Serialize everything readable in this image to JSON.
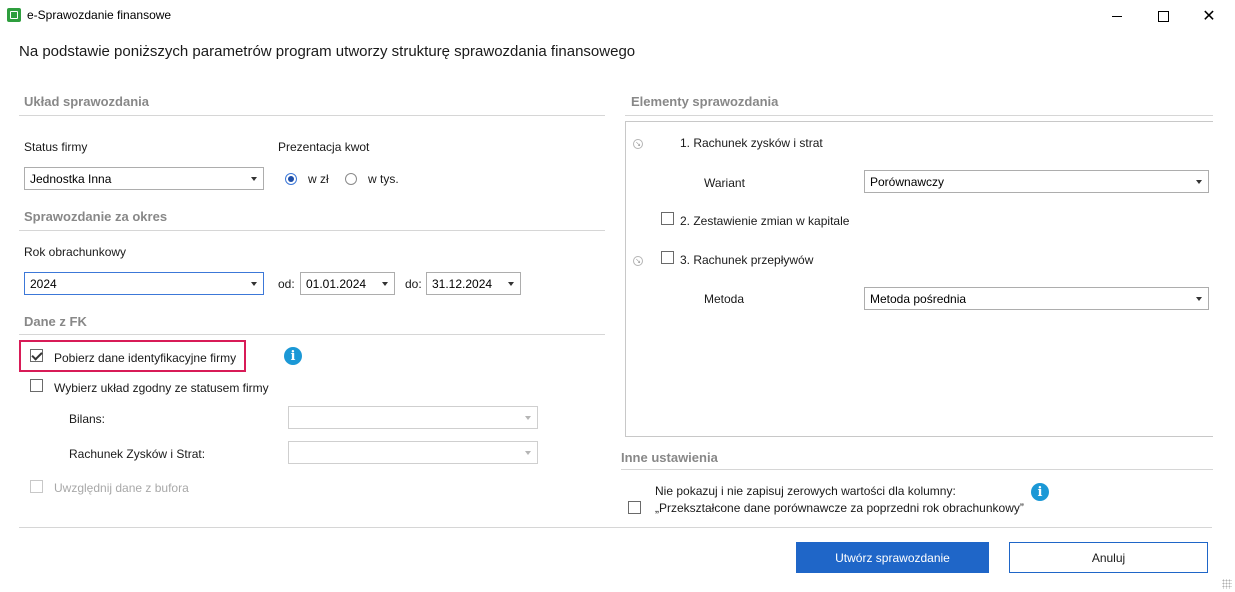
{
  "window": {
    "title": "e-Sprawozdanie finansowe",
    "heading": "Na podstawie poniższych parametrów program utworzy strukturę sprawozdania finansowego",
    "min_glyph": "",
    "close_glyph": "✕"
  },
  "uklad": {
    "title": "Układ sprawozdania",
    "status_label": "Status firmy",
    "status_value": "Jednostka Inna",
    "prezentacja_label": "Prezentacja kwot",
    "radio_zl": "w zł",
    "radio_tys": "w tys.",
    "radio_selected": "w zł"
  },
  "okres": {
    "title": "Sprawozdanie za okres",
    "rok_label": "Rok obrachunkowy",
    "rok_value": "2024",
    "od_label": "od:",
    "od_value": "01.01.2024",
    "do_label": "do:",
    "do_value": "31.12.2024"
  },
  "fk": {
    "title": "Dane z FK",
    "pobierz_label": "Pobierz dane identyfikacyjne firmy",
    "pobierz_checked": true,
    "wybierz_label": "Wybierz układ zgodny ze statusem firmy",
    "wybierz_checked": false,
    "bilans_label": "Bilans:",
    "rzis_label": "Rachunek Zysków i Strat:",
    "bufor_label": "Uwzględnij dane z bufora",
    "info_glyph": "i"
  },
  "elementy": {
    "title": "Elementy sprawozdania",
    "item1": "1. Rachunek zysków i strat",
    "wariant_label": "Wariant",
    "wariant_value": "Porównawczy",
    "item2": "2. Zestawienie zmian w kapitale",
    "item3": "3. Rachunek przepływów",
    "metoda_label": "Metoda",
    "metoda_value": "Metoda pośrednia",
    "expander_glyph": "↘"
  },
  "inne": {
    "title": "Inne ustawienia",
    "line1": "Nie pokazuj i nie zapisuj zerowych wartości dla kolumny:",
    "line2": "„Przekształcone dane porównawcze za poprzedni rok obrachunkowy”",
    "info_glyph": "i"
  },
  "buttons": {
    "create": "Utwórz sprawozdanie",
    "cancel": "Anuluj"
  },
  "colors": {
    "primary": "#1f66c8",
    "highlight": "#d81b57",
    "info": "#1b98d6"
  }
}
